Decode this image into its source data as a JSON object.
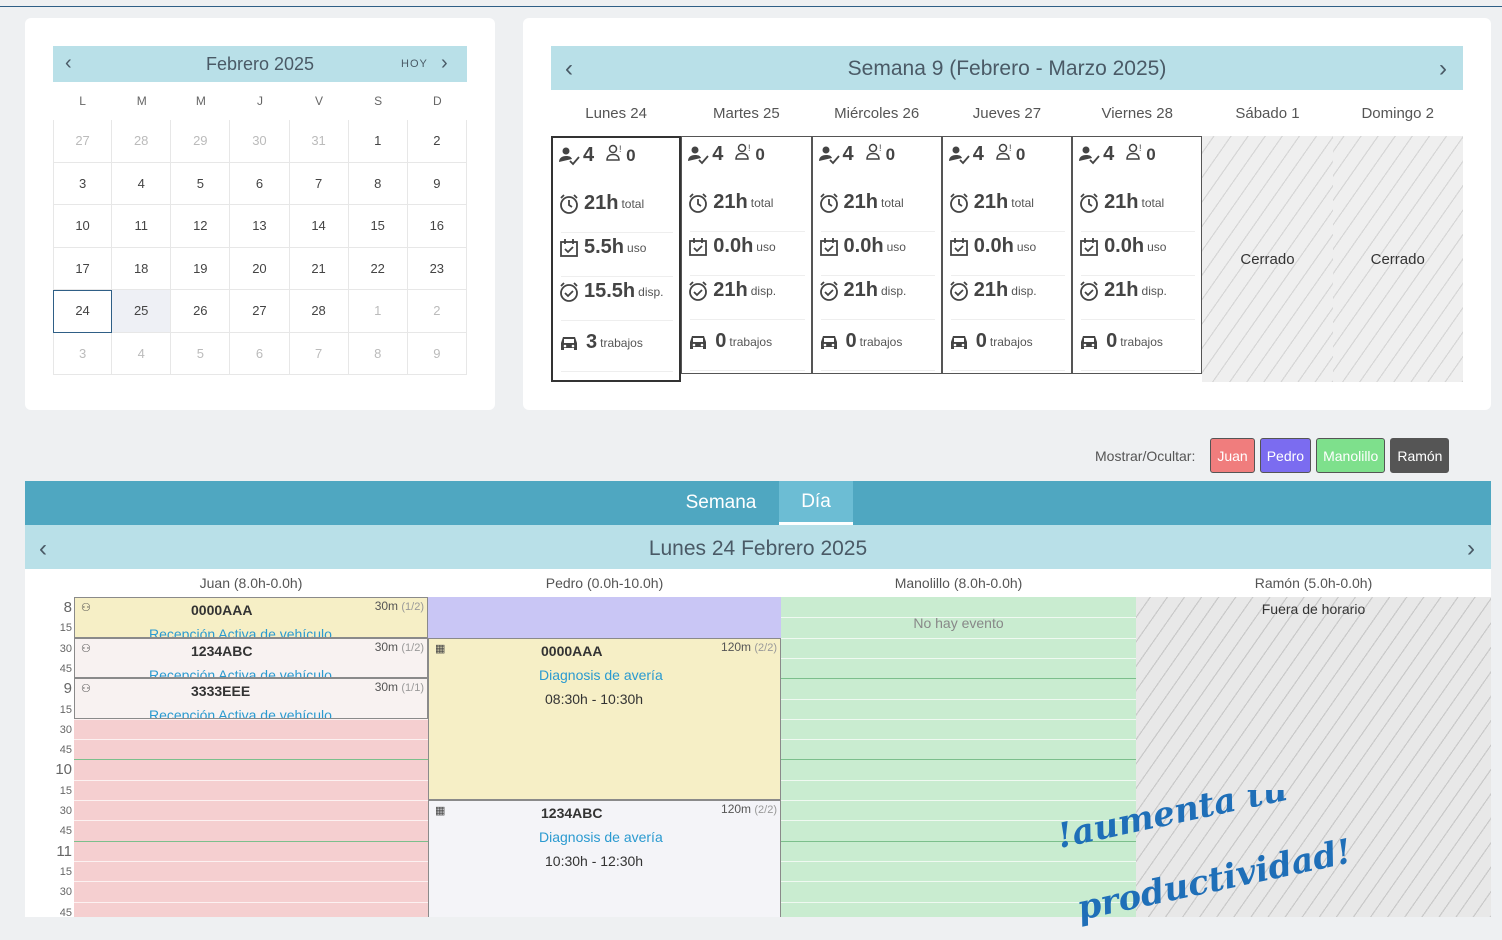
{
  "mini_calendar": {
    "title": "Febrero 2025",
    "today_label": "HOY",
    "weekdays": [
      "L",
      "M",
      "M",
      "J",
      "V",
      "S",
      "D"
    ],
    "weeks": [
      [
        "27",
        "28",
        "29",
        "30",
        "31",
        "1",
        "2"
      ],
      [
        "3",
        "4",
        "5",
        "6",
        "7",
        "8",
        "9"
      ],
      [
        "10",
        "11",
        "12",
        "13",
        "14",
        "15",
        "16"
      ],
      [
        "17",
        "18",
        "19",
        "20",
        "21",
        "22",
        "23"
      ],
      [
        "24",
        "25",
        "26",
        "27",
        "28",
        "1",
        "2"
      ],
      [
        "3",
        "4",
        "5",
        "6",
        "7",
        "8",
        "9"
      ]
    ]
  },
  "week_view": {
    "title": "Semana 9 (Febrero - Marzo 2025)",
    "days": [
      {
        "label": "Lunes 24",
        "people": "4",
        "absent": "0",
        "total": "21h",
        "use": "5.5h",
        "avail": "15.5h",
        "jobs": "3"
      },
      {
        "label": "Martes 25",
        "people": "4",
        "absent": "0",
        "total": "21h",
        "use": "0.0h",
        "avail": "21h",
        "jobs": "0"
      },
      {
        "label": "Miércoles 26",
        "people": "4",
        "absent": "0",
        "total": "21h",
        "use": "0.0h",
        "avail": "21h",
        "jobs": "0"
      },
      {
        "label": "Jueves 27",
        "people": "4",
        "absent": "0",
        "total": "21h",
        "use": "0.0h",
        "avail": "21h",
        "jobs": "0"
      },
      {
        "label": "Viernes 28",
        "people": "4",
        "absent": "0",
        "total": "21h",
        "use": "0.0h",
        "avail": "21h",
        "jobs": "0"
      },
      {
        "label": "Sábado 1",
        "closed": "Cerrado"
      },
      {
        "label": "Domingo 2",
        "closed": "Cerrado"
      }
    ],
    "units": {
      "total": "total",
      "use": "uso",
      "avail": "disp.",
      "avail_first": "disp.",
      "jobs": "trabajos"
    }
  },
  "toggles": {
    "label": "Mostrar/Ocultar:",
    "people": [
      {
        "name": "Juan",
        "color": "#f07d7d"
      },
      {
        "name": "Pedro",
        "color": "#7b6cf0"
      },
      {
        "name": "Manolillo",
        "color": "#7ee08c"
      },
      {
        "name": "Ramón",
        "color": "#555555"
      }
    ]
  },
  "day_view": {
    "tabs": [
      "Semana",
      "Día"
    ],
    "active_tab": "Día",
    "title": "Lunes 24 Febrero 2025",
    "columns": [
      {
        "header": "Juan (8.0h-0.0h)",
        "bg": "#f5cfd0"
      },
      {
        "header": "Pedro (0.0h-10.0h)",
        "bg": "#ffffff"
      },
      {
        "header": "Manolillo (8.0h-0.0h)",
        "bg": "#c9ecd0"
      },
      {
        "header": "Ramón (5.0h-0.0h)",
        "bg": "#e6e6e6"
      }
    ],
    "time_labels": [
      {
        "t": "8",
        "big": true
      },
      {
        "t": "15"
      },
      {
        "t": "30"
      },
      {
        "t": "45"
      },
      {
        "t": "9",
        "big": true
      },
      {
        "t": "15"
      },
      {
        "t": "30"
      },
      {
        "t": "45"
      },
      {
        "t": "10",
        "big": true
      },
      {
        "t": "15"
      },
      {
        "t": "30"
      },
      {
        "t": "45"
      },
      {
        "t": "11",
        "big": true
      },
      {
        "t": "15"
      },
      {
        "t": "30"
      },
      {
        "t": "45"
      }
    ],
    "juan_events": [
      {
        "plate": "0000AAA",
        "dur": "30m",
        "part": "(1/2)",
        "type": "Recepción Activa de vehículo"
      },
      {
        "plate": "1234ABC",
        "dur": "30m",
        "part": "(1/2)",
        "type": "Recepción Activa de vehículo"
      },
      {
        "plate": "3333EEE",
        "dur": "30m",
        "part": "(1/1)",
        "type": "Recepción Activa de vehículo"
      }
    ],
    "pedro_events": [
      {
        "plate": "0000AAA",
        "dur": "120m",
        "part": "(2/2)",
        "type": "Diagnosis de avería",
        "hours": "08:30h - 10:30h"
      },
      {
        "plate": "1234ABC",
        "dur": "120m",
        "part": "(2/2)",
        "type": "Diagnosis de avería",
        "hours": "10:30h - 12:30h"
      }
    ],
    "manolillo_empty": "No hay evento",
    "ramon_out": "Fuera de horario"
  },
  "slogan": {
    "line1": "!aumenta tu",
    "line2": "productividad!",
    "color": "#1f6fb8"
  }
}
